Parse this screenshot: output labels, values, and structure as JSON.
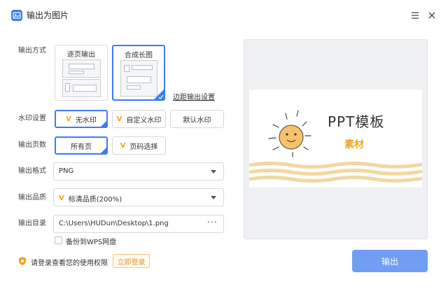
{
  "window": {
    "title": "输出为图片",
    "icon": "image-export-icon"
  },
  "labels": {
    "output_mode": "输出方式",
    "watermark": "水印设置",
    "pages": "输出页数",
    "format": "输出格式",
    "quality": "输出品质",
    "directory": "输出目录"
  },
  "layout_options": [
    {
      "label": "逐页输出",
      "selected": false
    },
    {
      "label": "合成长图",
      "selected": true
    }
  ],
  "margin_link": "边距输出设置",
  "watermark_options": [
    {
      "label": "无水印",
      "vip": true,
      "selected": true
    },
    {
      "label": "自定义水印",
      "vip": true,
      "selected": false
    },
    {
      "label": "默认水印",
      "vip": false,
      "selected": false
    }
  ],
  "page_options": [
    {
      "label": "所有页",
      "vip": false,
      "selected": true
    },
    {
      "label": "页码选择",
      "vip": true,
      "selected": false
    }
  ],
  "format": {
    "value": "PNG"
  },
  "quality": {
    "value": "标清品质(200%)",
    "vip": true
  },
  "directory": {
    "value": "C:\\Users\\HUDun\\Desktop\\1.png",
    "more": "···"
  },
  "backup": {
    "label": "备份到WPS网盘",
    "checked": false
  },
  "login": {
    "tip": "请登录查看您的使用权限",
    "button": "立即登录"
  },
  "preview": {
    "title": "PPT模板",
    "subtitle": "素材"
  },
  "export_button": "输出",
  "vip_mark": "V",
  "colors": {
    "accent": "#3d7bf2",
    "vip": "#f0a51e",
    "export_button": "#6f9ef3",
    "preview_bg": "#eef0f2"
  }
}
